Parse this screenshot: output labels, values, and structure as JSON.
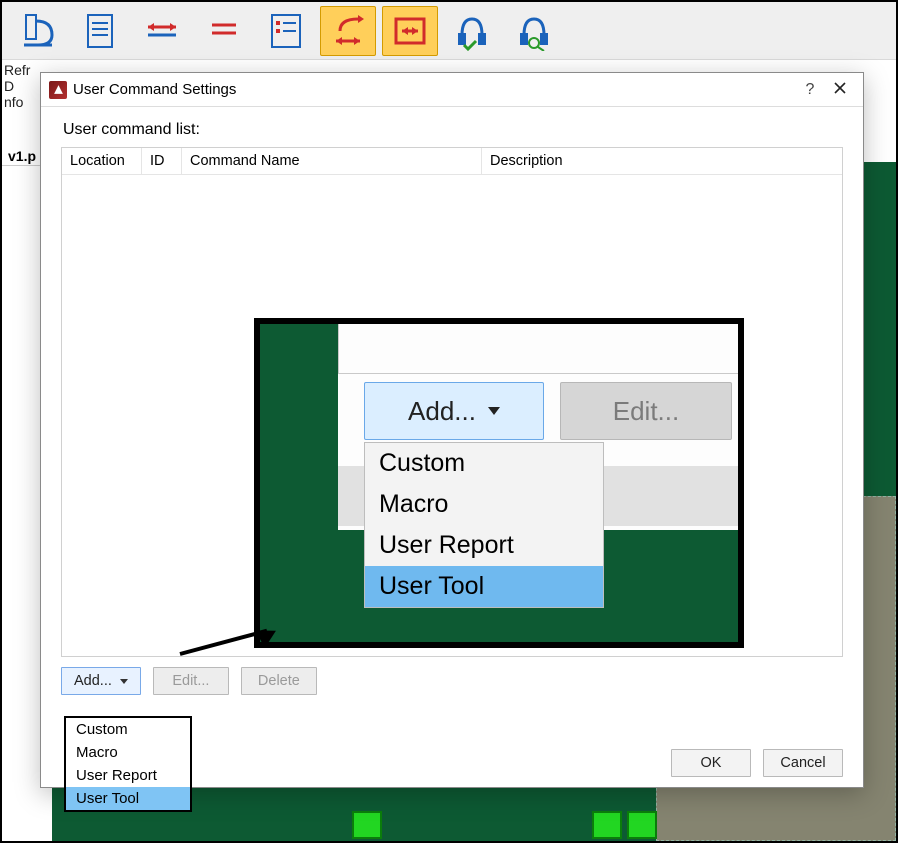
{
  "ribbon": {
    "labels": {
      "l1": "Refr",
      "l2": "D",
      "l3": "nfo"
    },
    "fileTab": "v1.p"
  },
  "dialog": {
    "title": "User Command Settings",
    "listLabel": "User command list:",
    "columns": {
      "loc": "Location",
      "id": "ID",
      "cmd": "Command Name",
      "desc": "Description"
    },
    "buttons": {
      "add": "Add...",
      "edit": "Edit...",
      "delete": "Delete",
      "ok": "OK",
      "cancel": "Cancel"
    },
    "help": "?"
  },
  "menu": {
    "items": [
      "Custom",
      "Macro",
      "User Report",
      "User Tool"
    ],
    "selectedIndex": 3
  },
  "callout": {
    "add": "Add...",
    "edit": "Edit...",
    "menu": [
      "Custom",
      "Macro",
      "User Report",
      "User Tool"
    ],
    "selectedIndex": 3
  }
}
